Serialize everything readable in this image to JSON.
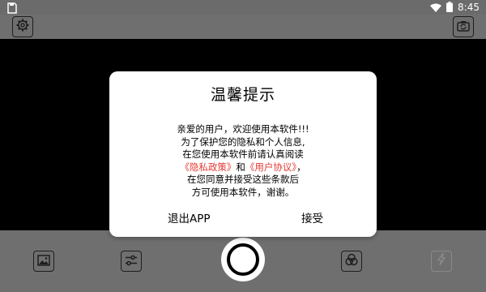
{
  "status_bar": {
    "time": "8:45",
    "left_icon": "save-icon",
    "icons": [
      "wifi-icon",
      "battery-icon"
    ]
  },
  "top_toolbar": {
    "settings_icon": "gear-icon",
    "switch_camera_icon": "switch-camera-icon"
  },
  "dialog": {
    "title": "温馨提示",
    "body": {
      "line1": "亲爱的用户，欢迎使用本软件!!!",
      "line2": "为了保护您的隐私和个人信息,",
      "line3": "在您使用本软件前请认真阅读",
      "privacy_policy_link": "《隐私政策》",
      "and_text": "和",
      "user_agreement_link": "《用户协议》",
      "trailing_comma": "，",
      "line5": "在您同意并接受这些条款后",
      "line6": "方可使用本软件，谢谢。"
    },
    "exit_button": "退出APP",
    "accept_button": "接受"
  },
  "bottom_bar": {
    "gallery_icon": "image-icon",
    "adjust_icon": "sliders-icon",
    "shutter": "shutter-button",
    "filter_icon": "filters-icon",
    "flash_icon": "flash-icon"
  },
  "colors": {
    "link": "#e53935",
    "dialog_bg": "#ffffff",
    "preview_bg": "#000000",
    "chrome_bg": "#6f6f6f"
  }
}
